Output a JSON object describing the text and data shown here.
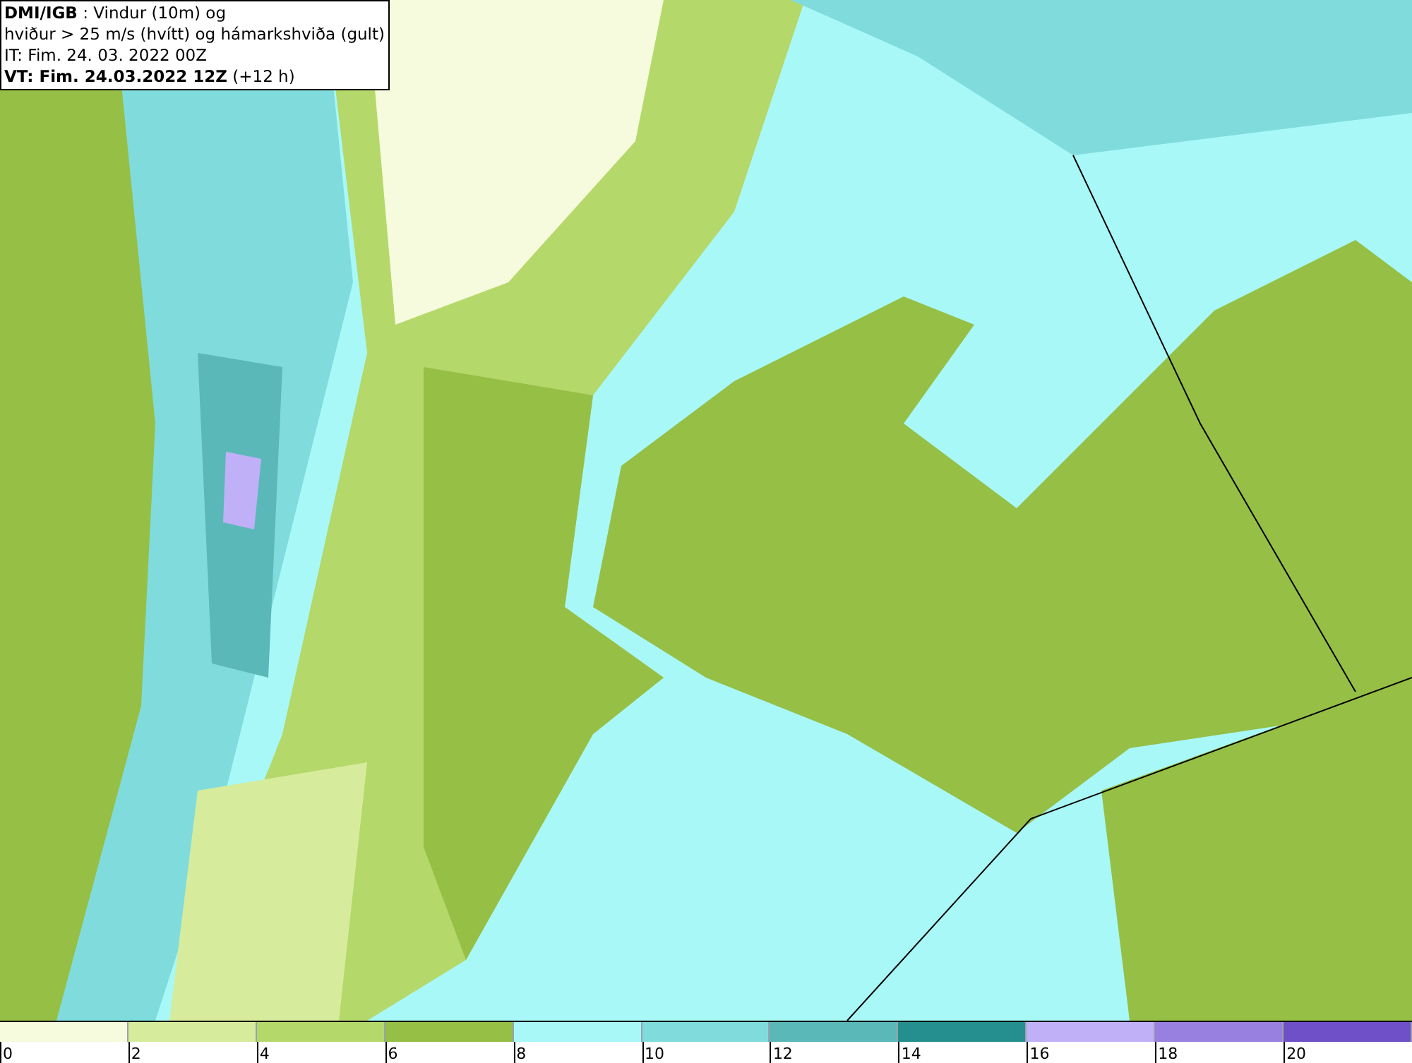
{
  "info": {
    "lines": [
      "**DMI/IGB** : Vindur (10m) og",
      "hviður > 25 m/s (hvítt) og hámarkshviða (gult)",
      "IT: Fim. 24. 03. 2022 00Z",
      "**VT: Fim. 24.03.2022 12Z** (+12 h)"
    ]
  },
  "legend": {
    "bins": [
      {
        "color": "#f5fbdc",
        "label": "0"
      },
      {
        "color": "#d6ec9c",
        "label": "2"
      },
      {
        "color": "#b5d86a",
        "label": "4"
      },
      {
        "color": "#96bf46",
        "label": "6"
      },
      {
        "color": "#a8f8f8",
        "label": "8"
      },
      {
        "color": "#80dcdc",
        "label": "10"
      },
      {
        "color": "#5ab8b8",
        "label": "12"
      },
      {
        "color": "#258f8f",
        "label": "14"
      },
      {
        "color": "#c0b0f8",
        "label": "16"
      },
      {
        "color": "#9880e0",
        "label": "18"
      },
      {
        "color": "#7050c8",
        "label": "20"
      }
    ]
  }
}
